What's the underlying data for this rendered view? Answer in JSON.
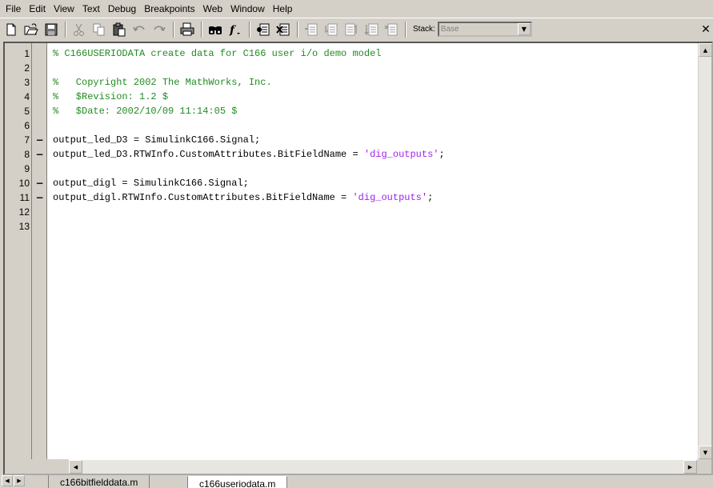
{
  "menu": [
    "File",
    "Edit",
    "View",
    "Text",
    "Debug",
    "Breakpoints",
    "Web",
    "Window",
    "Help"
  ],
  "toolbar": {
    "stack_label": "Stack:",
    "stack_value": "Base",
    "icons": [
      "new-file-icon",
      "open-icon",
      "save-icon",
      "cut-icon",
      "copy-icon",
      "paste-icon",
      "undo-icon",
      "redo-icon",
      "print-icon",
      "find-icon",
      "function-icon",
      "set-breakpoint-icon",
      "clear-breakpoint-icon",
      "step-icon",
      "step-in-icon",
      "step-out-icon",
      "continue-icon",
      "exit-debug-icon"
    ]
  },
  "editor": {
    "line_numbers": [
      "1",
      "2",
      "3",
      "4",
      "5",
      "6",
      "7",
      "8",
      "9",
      "10",
      "11",
      "12",
      "13"
    ],
    "markers": [
      "",
      "",
      "",
      "",
      "",
      "",
      "−",
      "−",
      "",
      "−",
      "−",
      "",
      ""
    ],
    "lines": [
      {
        "kind": "comment",
        "text": "% C166USERIODATA create data for C166 user i/o demo model"
      },
      {
        "kind": "blank",
        "text": ""
      },
      {
        "kind": "comment",
        "text": "%   Copyright 2002 The MathWorks, Inc."
      },
      {
        "kind": "comment",
        "text": "%   $Revision: 1.2 $"
      },
      {
        "kind": "comment",
        "text": "%   $Date: 2002/10/09 11:14:05 $"
      },
      {
        "kind": "blank",
        "text": ""
      },
      {
        "kind": "code",
        "text": "output_led_D3 = SimulinkC166.Signal;"
      },
      {
        "kind": "code_str",
        "text": "output_led_D3.RTWInfo.CustomAttributes.BitFieldName = ",
        "str": "'dig_outputs'",
        "tail": ";"
      },
      {
        "kind": "blank",
        "text": ""
      },
      {
        "kind": "code",
        "text": "output_digl = SimulinkC166.Signal;"
      },
      {
        "kind": "code_str",
        "text": "output_digl.RTWInfo.CustomAttributes.BitFieldName = ",
        "str": "'dig_outputs'",
        "tail": ";"
      },
      {
        "kind": "blank",
        "text": ""
      },
      {
        "kind": "blank",
        "text": ""
      }
    ]
  },
  "tabs": [
    {
      "label": "c166bitfielddata.m",
      "active": false
    },
    {
      "label": "c166useriodata.m",
      "active": true
    }
  ],
  "colors": {
    "comment": "#228b22",
    "string": "#a020f0"
  }
}
